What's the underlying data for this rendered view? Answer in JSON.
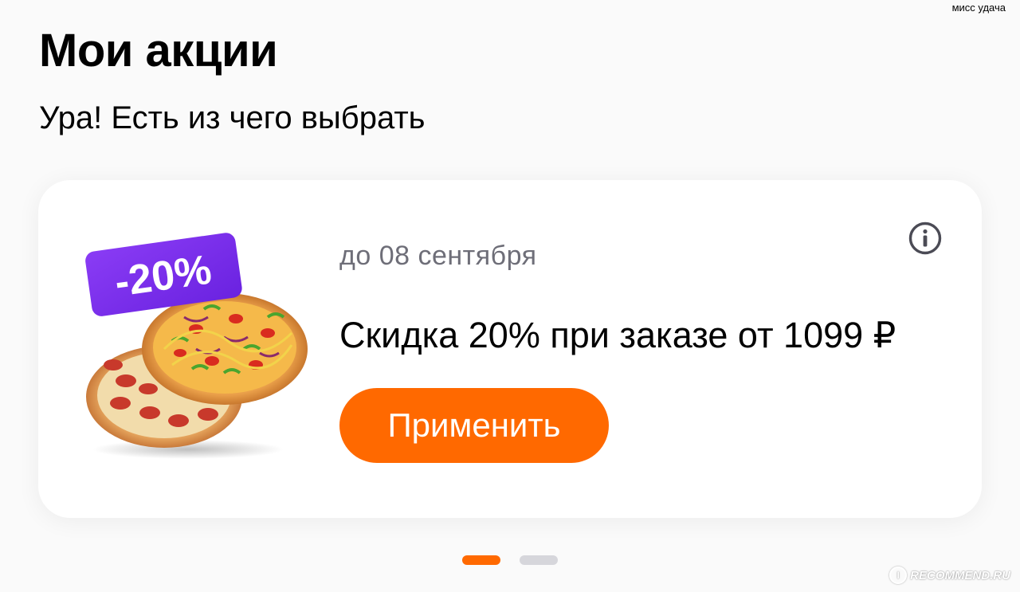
{
  "watermark_top": "мисс удача",
  "header": {
    "title": "Мои акции",
    "subtitle": "Ура! Есть из чего выбрать"
  },
  "promo_card": {
    "badge_text": "-20%",
    "date": "до 08 сентября",
    "offer": "Скидка 20% при заказе от 1099 ₽",
    "apply_button": "Применить",
    "info_icon": "info-icon"
  },
  "pager": {
    "total": 2,
    "active_index": 0
  },
  "watermark_bottom": {
    "badge": "I",
    "text": "RECOMMEND.RU"
  },
  "colors": {
    "accent": "#ff6900",
    "badge_purple": "#7b2ff7",
    "date_gray": "#6e6e78",
    "inactive_dot": "#d6d6db"
  }
}
